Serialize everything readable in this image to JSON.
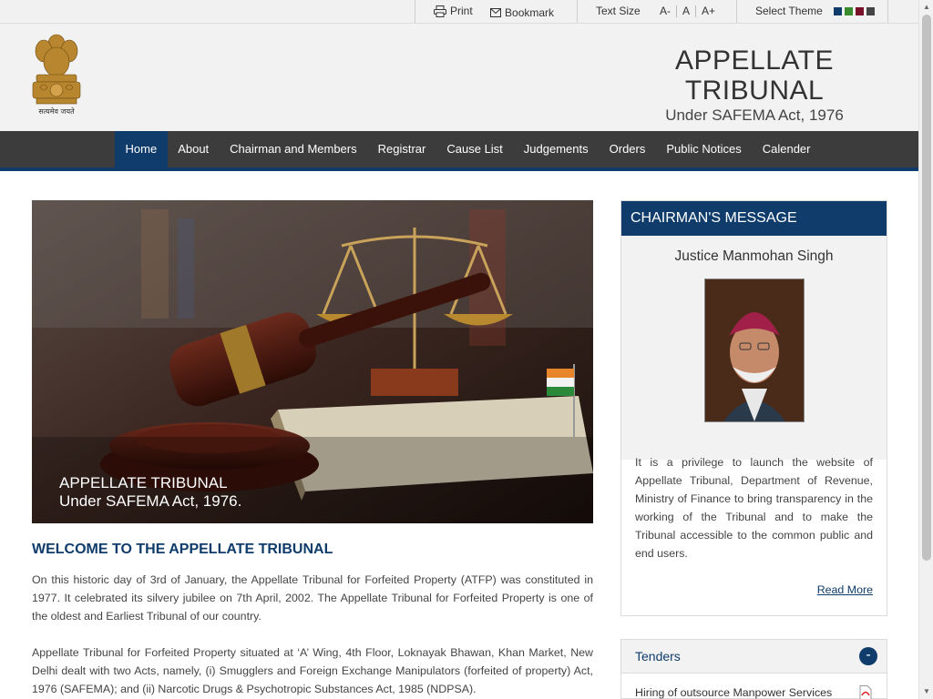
{
  "topbar": {
    "print_label": "Print",
    "bookmark_label": "Bookmark",
    "text_size_label": "Text Size",
    "text_size_options": [
      "A-",
      "A",
      "A+"
    ],
    "select_theme_label": "Select Theme",
    "theme_colors": [
      "#0f3c6b",
      "#3a8a2e",
      "#7a0f2a",
      "#444444"
    ]
  },
  "header": {
    "emblem_caption": "सत्यमेव जयते",
    "title": "APPELLATE TRIBUNAL",
    "subtitle": "Under SAFEMA Act, 1976"
  },
  "nav": {
    "items": [
      "Home",
      "About",
      "Chairman and Members",
      "Registrar",
      "Cause List",
      "Judgements",
      "Orders",
      "Public Notices",
      "Calender"
    ],
    "active": "Home"
  },
  "banner": {
    "caption_line1": "APPELLATE TRIBUNAL",
    "caption_line2": "Under SAFEMA Act, 1976."
  },
  "main": {
    "welcome_heading": "WELCOME TO THE APPELLATE TRIBUNAL",
    "para1": "On this historic day of 3rd of January, the Appellate Tribunal for Forfeited Property (ATFP) was constituted in 1977. It celebrated its silvery jubilee on 7th April, 2002. The Appellate Tribunal for Forfeited Property is one of the oldest and Earliest Tribunal of our country.",
    "para2": "Appellate Tribunal for Forfeited Property situated at ‘A’ Wing, 4th Floor, Loknayak Bhawan, Khan Market, New Delhi dealt with two Acts, namely, (i) Smugglers and Foreign Exchange Manipulators (forfeited of property) Act, 1976 (SAFEMA); and (ii) Narcotic Drugs & Psychotropic Substances Act, 1985 (NDPSA)."
  },
  "chairman": {
    "heading": "CHAIRMAN'S MESSAGE",
    "name": "Justice Manmohan Singh",
    "message": "It is a privilege to launch the website of Appellate Tribunal, Department of Revenue, Ministry of Finance to bring transparency in the working of the Tribunal and to make the Tribunal accessible to the common public and end users.",
    "read_more": "Read More"
  },
  "tenders": {
    "heading": "Tenders",
    "toggle": "-",
    "items": [
      "Hiring of outsource Manpower Services"
    ]
  }
}
